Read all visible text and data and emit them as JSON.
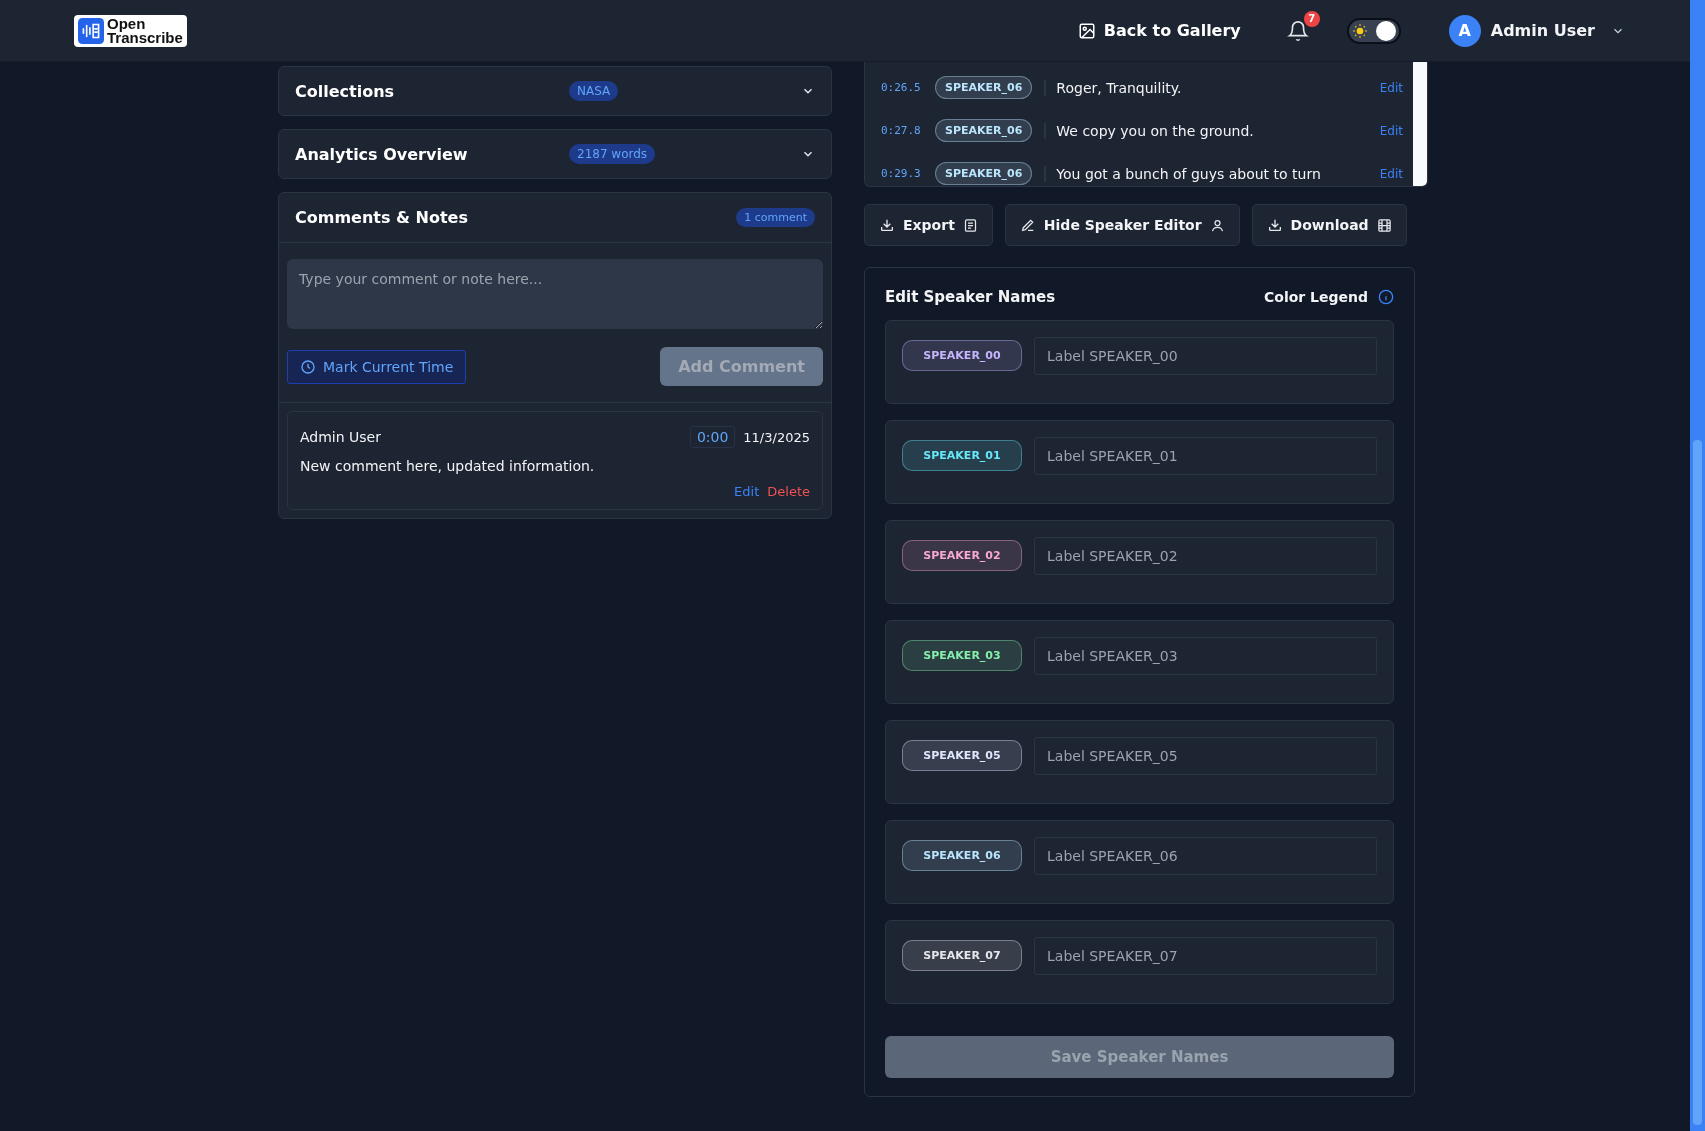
{
  "header": {
    "logo": {
      "line1": "Open",
      "line2": "Transcribe"
    },
    "back_link": "Back to Gallery",
    "notifications": {
      "count": "7"
    },
    "theme_toggle": {
      "on": true
    },
    "user": {
      "initial": "A",
      "name": "Admin User"
    }
  },
  "sections": [
    {
      "title": "Collections",
      "badge": "NASA",
      "expanded": false
    },
    {
      "title": "Analytics Overview",
      "badge": "2187 words",
      "expanded": false
    }
  ],
  "comments": {
    "title": "Comments & Notes",
    "badge": "1 comment",
    "input": {
      "placeholder": "Type your comment or note here..."
    },
    "mark_button": "Mark Current Time",
    "add_button": {
      "label": "Add Comment",
      "disabled": true
    },
    "items": [
      {
        "author": "Admin User",
        "time": "0:00",
        "date": "11/3/2025",
        "text": "New comment here, updated information.",
        "edit": "Edit",
        "delete": "Delete"
      }
    ]
  },
  "transcript": [
    {
      "time": "0:26.5",
      "speaker": "SPEAKER_06",
      "color": "#bae6fd",
      "text": "Roger, Tranquility.",
      "edit": "Edit"
    },
    {
      "time": "0:27.8",
      "speaker": "SPEAKER_06",
      "color": "#bae6fd",
      "text": "We copy you on the ground.",
      "edit": "Edit"
    },
    {
      "time": "0:29.3",
      "speaker": "SPEAKER_06",
      "color": "#bae6fd",
      "text": "You got a bunch of guys about to turn",
      "edit": "Edit"
    }
  ],
  "actions": [
    {
      "label": "Export",
      "kind": "export"
    },
    {
      "label": "Hide Speaker Editor",
      "kind": "speaker"
    },
    {
      "label": "Download",
      "kind": "download"
    }
  ],
  "speaker_editor": {
    "title": "Edit Speaker Names",
    "legend": "Color Legend",
    "speakers": [
      {
        "name": "SPEAKER_00",
        "color": "#c4b5fd",
        "placeholder": "Label SPEAKER_00"
      },
      {
        "name": "SPEAKER_01",
        "color": "#67e8f9",
        "placeholder": "Label SPEAKER_01"
      },
      {
        "name": "SPEAKER_02",
        "color": "#f9a8d4",
        "placeholder": "Label SPEAKER_02"
      },
      {
        "name": "SPEAKER_03",
        "color": "#86efac",
        "placeholder": "Label SPEAKER_03"
      },
      {
        "name": "SPEAKER_05",
        "color": "#e0e7ff",
        "placeholder": "Label SPEAKER_05"
      },
      {
        "name": "SPEAKER_06",
        "color": "#bae6fd",
        "placeholder": "Label SPEAKER_06"
      },
      {
        "name": "SPEAKER_07",
        "color": "#e5e7eb",
        "placeholder": "Label SPEAKER_07"
      }
    ],
    "save_button": {
      "label": "Save Speaker Names",
      "disabled": true
    }
  }
}
